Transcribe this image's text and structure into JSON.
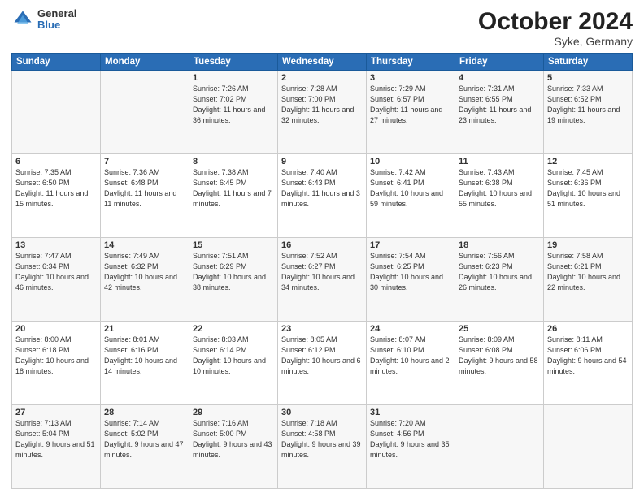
{
  "header": {
    "logo_general": "General",
    "logo_blue": "Blue",
    "month_title": "October 2024",
    "location": "Syke, Germany"
  },
  "weekdays": [
    "Sunday",
    "Monday",
    "Tuesday",
    "Wednesday",
    "Thursday",
    "Friday",
    "Saturday"
  ],
  "weeks": [
    [
      {
        "day": "",
        "sunrise": "",
        "sunset": "",
        "daylight": ""
      },
      {
        "day": "",
        "sunrise": "",
        "sunset": "",
        "daylight": ""
      },
      {
        "day": "1",
        "sunrise": "Sunrise: 7:26 AM",
        "sunset": "Sunset: 7:02 PM",
        "daylight": "Daylight: 11 hours and 36 minutes."
      },
      {
        "day": "2",
        "sunrise": "Sunrise: 7:28 AM",
        "sunset": "Sunset: 7:00 PM",
        "daylight": "Daylight: 11 hours and 32 minutes."
      },
      {
        "day": "3",
        "sunrise": "Sunrise: 7:29 AM",
        "sunset": "Sunset: 6:57 PM",
        "daylight": "Daylight: 11 hours and 27 minutes."
      },
      {
        "day": "4",
        "sunrise": "Sunrise: 7:31 AM",
        "sunset": "Sunset: 6:55 PM",
        "daylight": "Daylight: 11 hours and 23 minutes."
      },
      {
        "day": "5",
        "sunrise": "Sunrise: 7:33 AM",
        "sunset": "Sunset: 6:52 PM",
        "daylight": "Daylight: 11 hours and 19 minutes."
      }
    ],
    [
      {
        "day": "6",
        "sunrise": "Sunrise: 7:35 AM",
        "sunset": "Sunset: 6:50 PM",
        "daylight": "Daylight: 11 hours and 15 minutes."
      },
      {
        "day": "7",
        "sunrise": "Sunrise: 7:36 AM",
        "sunset": "Sunset: 6:48 PM",
        "daylight": "Daylight: 11 hours and 11 minutes."
      },
      {
        "day": "8",
        "sunrise": "Sunrise: 7:38 AM",
        "sunset": "Sunset: 6:45 PM",
        "daylight": "Daylight: 11 hours and 7 minutes."
      },
      {
        "day": "9",
        "sunrise": "Sunrise: 7:40 AM",
        "sunset": "Sunset: 6:43 PM",
        "daylight": "Daylight: 11 hours and 3 minutes."
      },
      {
        "day": "10",
        "sunrise": "Sunrise: 7:42 AM",
        "sunset": "Sunset: 6:41 PM",
        "daylight": "Daylight: 10 hours and 59 minutes."
      },
      {
        "day": "11",
        "sunrise": "Sunrise: 7:43 AM",
        "sunset": "Sunset: 6:38 PM",
        "daylight": "Daylight: 10 hours and 55 minutes."
      },
      {
        "day": "12",
        "sunrise": "Sunrise: 7:45 AM",
        "sunset": "Sunset: 6:36 PM",
        "daylight": "Daylight: 10 hours and 51 minutes."
      }
    ],
    [
      {
        "day": "13",
        "sunrise": "Sunrise: 7:47 AM",
        "sunset": "Sunset: 6:34 PM",
        "daylight": "Daylight: 10 hours and 46 minutes."
      },
      {
        "day": "14",
        "sunrise": "Sunrise: 7:49 AM",
        "sunset": "Sunset: 6:32 PM",
        "daylight": "Daylight: 10 hours and 42 minutes."
      },
      {
        "day": "15",
        "sunrise": "Sunrise: 7:51 AM",
        "sunset": "Sunset: 6:29 PM",
        "daylight": "Daylight: 10 hours and 38 minutes."
      },
      {
        "day": "16",
        "sunrise": "Sunrise: 7:52 AM",
        "sunset": "Sunset: 6:27 PM",
        "daylight": "Daylight: 10 hours and 34 minutes."
      },
      {
        "day": "17",
        "sunrise": "Sunrise: 7:54 AM",
        "sunset": "Sunset: 6:25 PM",
        "daylight": "Daylight: 10 hours and 30 minutes."
      },
      {
        "day": "18",
        "sunrise": "Sunrise: 7:56 AM",
        "sunset": "Sunset: 6:23 PM",
        "daylight": "Daylight: 10 hours and 26 minutes."
      },
      {
        "day": "19",
        "sunrise": "Sunrise: 7:58 AM",
        "sunset": "Sunset: 6:21 PM",
        "daylight": "Daylight: 10 hours and 22 minutes."
      }
    ],
    [
      {
        "day": "20",
        "sunrise": "Sunrise: 8:00 AM",
        "sunset": "Sunset: 6:18 PM",
        "daylight": "Daylight: 10 hours and 18 minutes."
      },
      {
        "day": "21",
        "sunrise": "Sunrise: 8:01 AM",
        "sunset": "Sunset: 6:16 PM",
        "daylight": "Daylight: 10 hours and 14 minutes."
      },
      {
        "day": "22",
        "sunrise": "Sunrise: 8:03 AM",
        "sunset": "Sunset: 6:14 PM",
        "daylight": "Daylight: 10 hours and 10 minutes."
      },
      {
        "day": "23",
        "sunrise": "Sunrise: 8:05 AM",
        "sunset": "Sunset: 6:12 PM",
        "daylight": "Daylight: 10 hours and 6 minutes."
      },
      {
        "day": "24",
        "sunrise": "Sunrise: 8:07 AM",
        "sunset": "Sunset: 6:10 PM",
        "daylight": "Daylight: 10 hours and 2 minutes."
      },
      {
        "day": "25",
        "sunrise": "Sunrise: 8:09 AM",
        "sunset": "Sunset: 6:08 PM",
        "daylight": "Daylight: 9 hours and 58 minutes."
      },
      {
        "day": "26",
        "sunrise": "Sunrise: 8:11 AM",
        "sunset": "Sunset: 6:06 PM",
        "daylight": "Daylight: 9 hours and 54 minutes."
      }
    ],
    [
      {
        "day": "27",
        "sunrise": "Sunrise: 7:13 AM",
        "sunset": "Sunset: 5:04 PM",
        "daylight": "Daylight: 9 hours and 51 minutes."
      },
      {
        "day": "28",
        "sunrise": "Sunrise: 7:14 AM",
        "sunset": "Sunset: 5:02 PM",
        "daylight": "Daylight: 9 hours and 47 minutes."
      },
      {
        "day": "29",
        "sunrise": "Sunrise: 7:16 AM",
        "sunset": "Sunset: 5:00 PM",
        "daylight": "Daylight: 9 hours and 43 minutes."
      },
      {
        "day": "30",
        "sunrise": "Sunrise: 7:18 AM",
        "sunset": "Sunset: 4:58 PM",
        "daylight": "Daylight: 9 hours and 39 minutes."
      },
      {
        "day": "31",
        "sunrise": "Sunrise: 7:20 AM",
        "sunset": "Sunset: 4:56 PM",
        "daylight": "Daylight: 9 hours and 35 minutes."
      },
      {
        "day": "",
        "sunrise": "",
        "sunset": "",
        "daylight": ""
      },
      {
        "day": "",
        "sunrise": "",
        "sunset": "",
        "daylight": ""
      }
    ]
  ]
}
